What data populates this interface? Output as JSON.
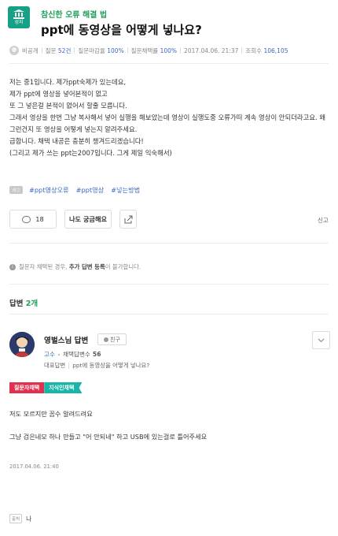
{
  "header": {
    "badge_label": "성지",
    "category": "참신한 오류 해결 법",
    "title": "ppt에 동영상을 어떻게 넣나요?"
  },
  "meta": {
    "author": "비공개",
    "question_count_label": "질문",
    "question_count": "52건",
    "deadline_rate_label": "질문마감율",
    "deadline_rate": "100%",
    "adopt_rate_label": "질문채택률",
    "adopt_rate": "100%",
    "datetime": "2017.04.06. 21:37",
    "views_label": "조회수",
    "views": "106,105"
  },
  "question_body": "저는 중1입니다. 제가ppt숙제가 있는데요,\n제가 ppt에 영상을 넣어본적이 없고\n또 그 넣은걸 본적이 없어서 할줄 모릅니다.\n그래서 영상을 한번 그냥 복사해서 넣어 실행을 해보았는데 영상이 실행도중 오류가떠 계속 영상이 안되더라고요. 왜 그런건지 또 영상을 어떻게 넣는지 알려주세요.\n급합니다. 채택 내공은 충분히 챙겨드리겠습니다!\n(그리고 제가 쓰는 ppt는2007입니다. 그게 제일 익숙해서)",
  "tags": {
    "icon_label": "태그",
    "items": [
      "#ppt영상오류",
      "#ppt영상",
      "#넣는방법"
    ]
  },
  "actions": {
    "comment_count": "18",
    "curious_label": "나도 궁금해요",
    "report_label": "신고"
  },
  "notice": {
    "prefix": "질문자 채택된 경우,",
    "bold": "추가 답변 등록",
    "suffix": "이 불가합니다."
  },
  "answers_header": {
    "label": "답변",
    "count": "2개"
  },
  "answer": {
    "name": "영벌스님 답변",
    "friend_label": "친구",
    "grade": "고수",
    "adopt_label": "채택답변수",
    "adopt_count": "56",
    "rep_label": "대표답변",
    "rep_title": "ppt에 동영상을 어떻게 넣나요?",
    "ribbon_asker": "질문자채택",
    "ribbon_kin": "지식인채택",
    "text1": "저도 모르지만 꼽수 알려드려요",
    "text2": "그냥 검은네모 하나 만들고 \"어 안되네\" 하고 USB에 있는걸로 틀어주세요",
    "date": "2017.04.06. 21:40"
  },
  "source": {
    "label": "출처",
    "value": "나"
  }
}
